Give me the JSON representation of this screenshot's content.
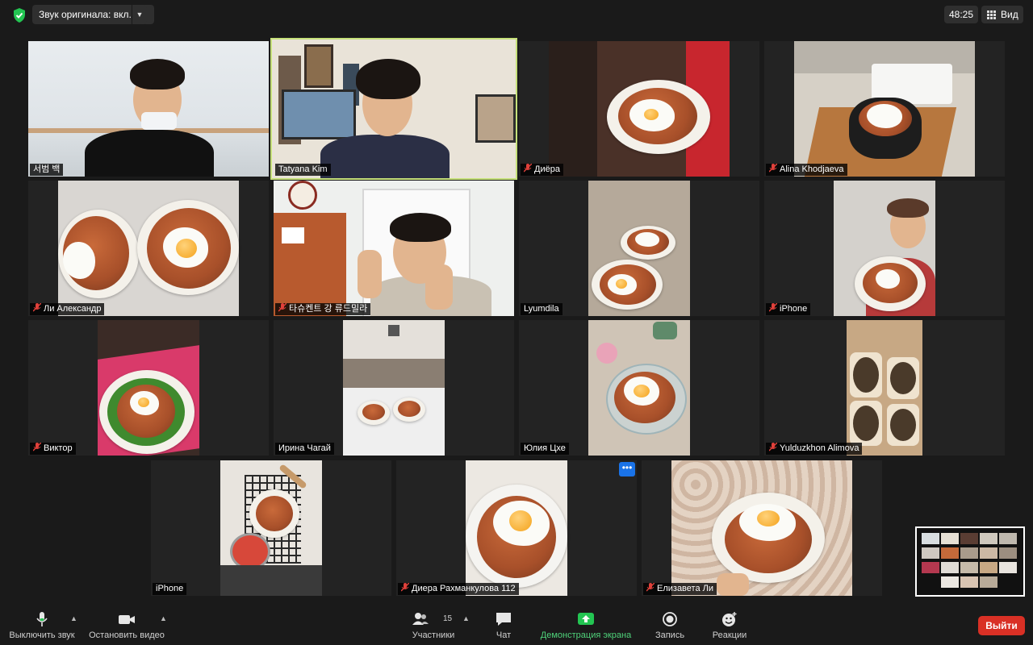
{
  "topbar": {
    "audio_label": "Звук оригинала: вкл.",
    "timer": "48:25",
    "view_label": "Вид"
  },
  "participants": [
    {
      "name": "서범 백",
      "muted": false
    },
    {
      "name": "Tatyana Kim",
      "muted": false,
      "active_speaker": true
    },
    {
      "name": "Диёра",
      "muted": true
    },
    {
      "name": "Alina Khodjaeva",
      "muted": true
    },
    {
      "name": "Ли Александр",
      "muted": true
    },
    {
      "name": "타슈켄트 강 류드밀라",
      "muted": true
    },
    {
      "name": "Lyumdila",
      "muted": false
    },
    {
      "name": "iPhone",
      "muted": true
    },
    {
      "name": "Виктор",
      "muted": true
    },
    {
      "name": "Ирина Чагай",
      "muted": false
    },
    {
      "name": "Юлия Цхе",
      "muted": false
    },
    {
      "name": "Yulduzkhon Alimova",
      "muted": true
    },
    {
      "name": "iPhone",
      "muted": false
    },
    {
      "name": "Диера Рахманкулова 112",
      "muted": true
    },
    {
      "name": "Елизавета Ли",
      "muted": true
    }
  ],
  "more_options": "•••",
  "toolbar": {
    "mute_label": "Выключить звук",
    "video_label": "Остановить видео",
    "participants_label": "Участники",
    "participants_count": "15",
    "chat_label": "Чат",
    "share_label": "Демонстрация экрана",
    "record_label": "Запись",
    "reactions_label": "Реакции",
    "leave_label": "Выйти"
  },
  "colors": {
    "active_speaker_border": "#c6e07a",
    "share_green": "#23c552",
    "leave_red": "#d93025",
    "more_blue": "#1a73e8"
  }
}
